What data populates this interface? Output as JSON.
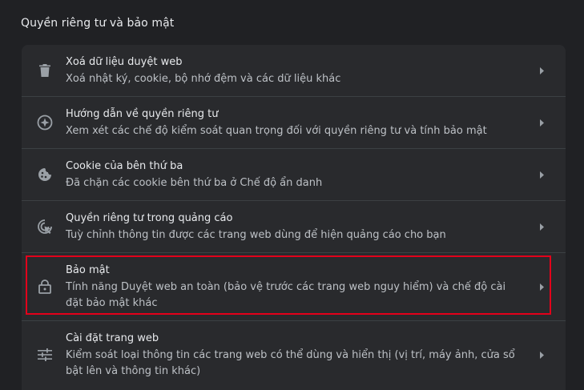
{
  "section": {
    "title": "Quyền riêng tư và bảo mật"
  },
  "items": [
    {
      "title": "Xoá dữ liệu duyệt web",
      "description": "Xoá nhật ký, cookie, bộ nhớ đệm và các dữ liệu khác",
      "icon": "trash-icon"
    },
    {
      "title": "Hướng dẫn về quyền riêng tư",
      "description": "Xem xét các chế độ kiểm soát quan trọng đối với quyền riêng tư và tính bảo mật",
      "icon": "compass-icon"
    },
    {
      "title": "Cookie của bên thứ ba",
      "description": "Đã chặn các cookie bên thứ ba ở Chế độ ẩn danh",
      "icon": "cookie-icon"
    },
    {
      "title": "Quyền riêng tư trong quảng cáo",
      "description": "Tuỳ chỉnh thông tin được các trang web dùng để hiện quảng cáo cho bạn",
      "icon": "ad-privacy-icon"
    },
    {
      "title": "Bảo mật",
      "description": "Tính năng Duyệt web an toàn (bảo vệ trước các trang web nguy hiểm) và chế độ cài đặt bảo mật khác",
      "icon": "lock-icon",
      "highlighted": true
    },
    {
      "title": "Cài đặt trang web",
      "description": "Kiểm soát loại thông tin các trang web có thể dùng và hiển thị (vị trí, máy ảnh, cửa sổ bật lên và thông tin khác)",
      "icon": "sliders-icon"
    }
  ],
  "colors": {
    "background": "#202124",
    "card": "#292a2d",
    "highlight": "#e3001b"
  }
}
